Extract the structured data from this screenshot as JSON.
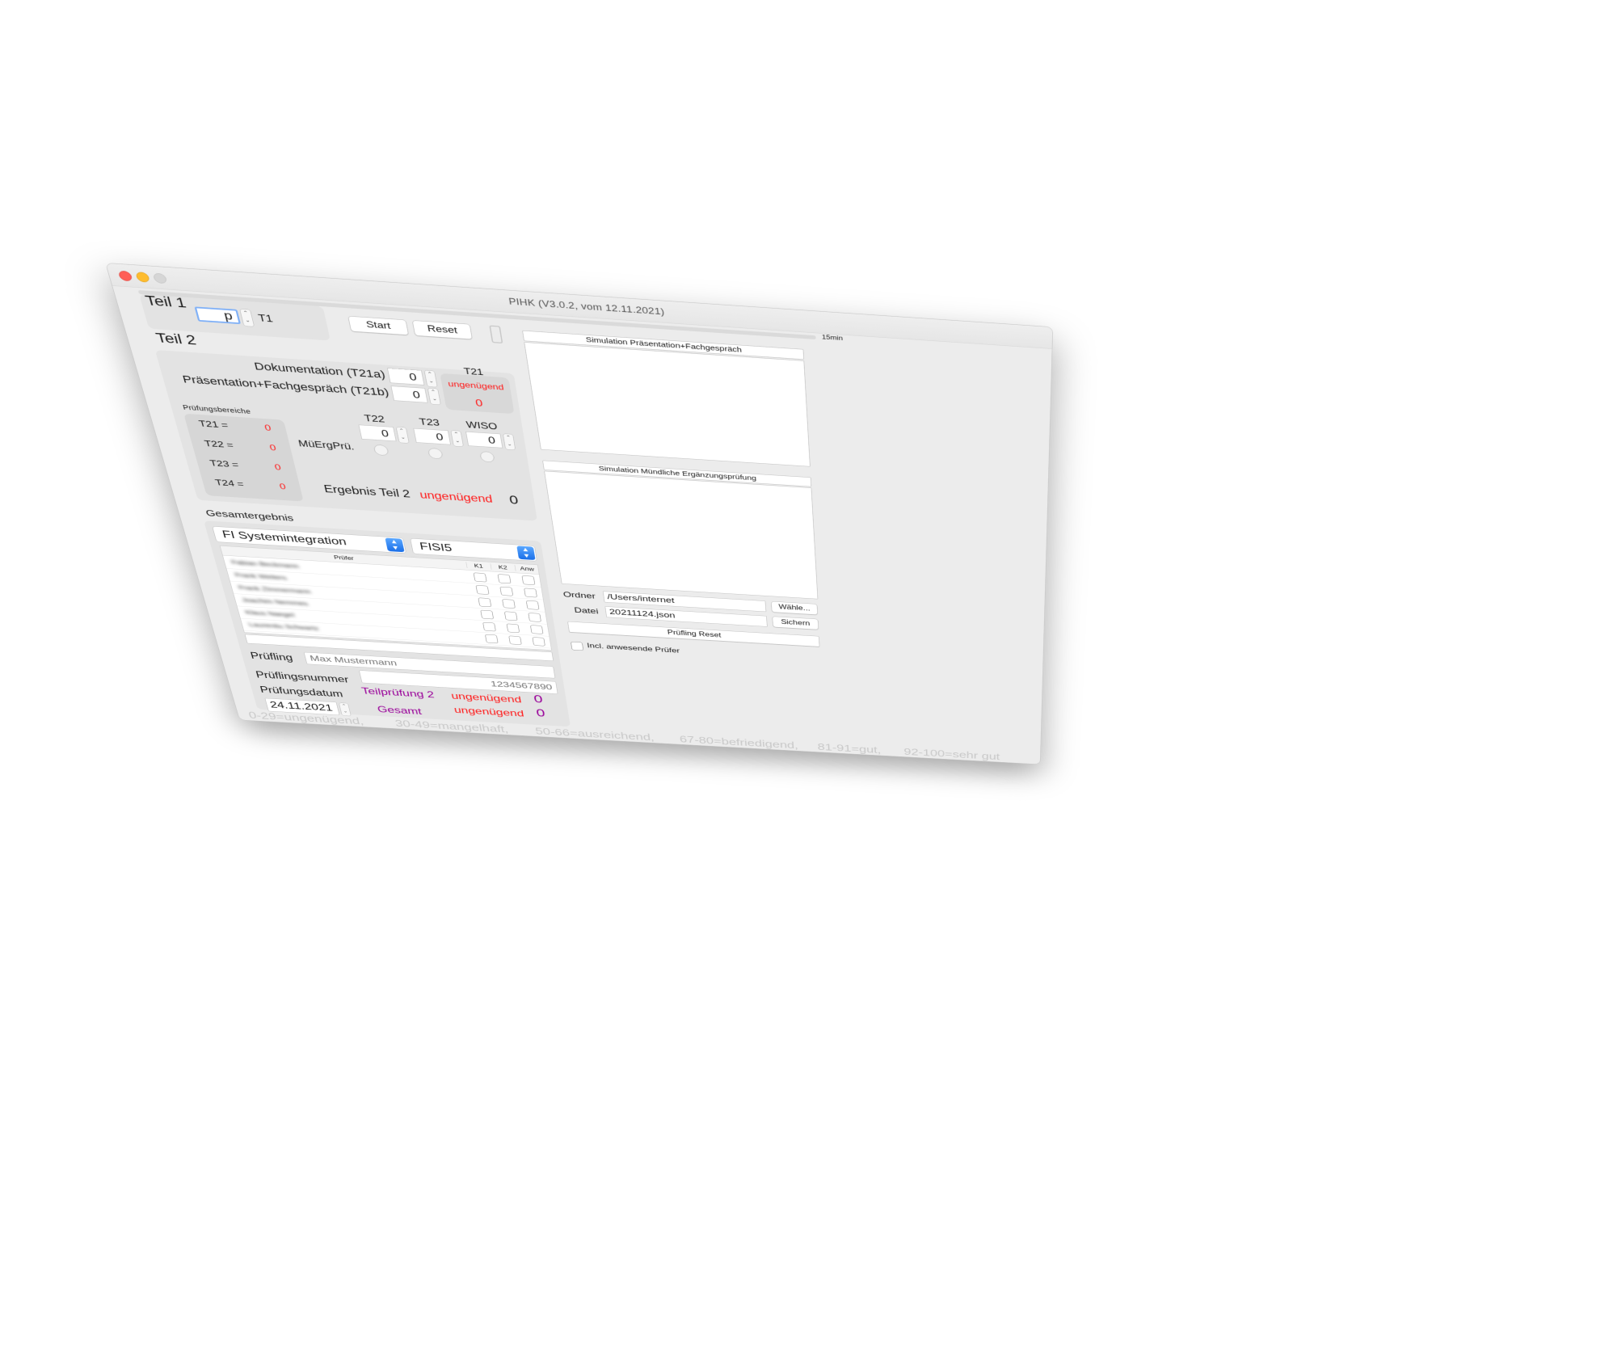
{
  "window": {
    "title": "PIHK   (V3.0.2, vom 12.11.2021)",
    "traffic_light_colors": [
      "#ff5f57",
      "#febc2e",
      "#d6d6d6"
    ]
  },
  "teil1": {
    "heading": "Teil 1",
    "input_value": "p",
    "t1_label": "T1",
    "start_label": "Start",
    "reset_label": "Reset"
  },
  "timer": {
    "label": "15min",
    "progress": 0
  },
  "teil2": {
    "heading": "Teil 2",
    "dok_label": "Dokumentation (T21a)",
    "dok_value": "0",
    "praes_label": "Präsentation+Fachgespräch (T21b)",
    "praes_value": "0",
    "t21_title": "T21",
    "t21_grade": "ungenügend",
    "t21_points": "0",
    "bereiche_title": "Prüfungsbereiche",
    "bereiche": [
      {
        "label": "T21 =",
        "value": "0"
      },
      {
        "label": "T22 =",
        "value": "0"
      },
      {
        "label": "T23 =",
        "value": "0"
      },
      {
        "label": "T24 =",
        "value": "0"
      }
    ],
    "t22_label": "T22",
    "t22_value": "0",
    "t23_label": "T23",
    "t23_value": "0",
    "wiso_label": "WISO",
    "wiso_value": "0",
    "mueerg_label": "MüErgPrü.",
    "ergebnis_label": "Ergebnis Teil 2",
    "ergebnis_grade": "ungenügend",
    "ergebnis_points": "0"
  },
  "gesamt": {
    "heading": "Gesamtergebnis",
    "beruf_selected": "FI Systemintegration",
    "kurs_selected": "FISI5",
    "table_headers": [
      "Prüfer",
      "K1",
      "K2",
      "Anw"
    ],
    "pruefer": [
      "Fabian Beckmann",
      "Frank Weiters",
      "Frank Zimmermann",
      "Joachim Nemmes",
      "Klaus Naegel",
      "Laurentiu Schwartz"
    ],
    "pruefling_label": "Prüfling",
    "pruefling_placeholder": "Max Mustermann",
    "nummer_label": "Prüflingsnummer",
    "nummer_placeholder": "1234567890",
    "datum_label": "Prüfungsdatum",
    "datum_value": "24.11.2021",
    "teilpruefung_label": "Teilprüfung 2",
    "teilpruefung_grade": "ungenügend",
    "teilpruefung_points": "0",
    "gesamt_label": "Gesamt",
    "gesamt_grade": "ungenügend",
    "gesamt_points": "0"
  },
  "simulation": {
    "praes_title": "Simulation Präsentation+Fachgespräch",
    "mueerg_title": "Simulation Mündliche Ergänzungsprüfung"
  },
  "files": {
    "ordner_label": "Ordner",
    "ordner_value": "/Users/internet",
    "waehle_label": "Wähle...",
    "datei_label": "Datei",
    "datei_value": "20211124.json",
    "sichern_label": "Sichern",
    "reset_label": "Prüfling Reset",
    "incl_label": "Incl. anwesende Prüfer"
  },
  "footer": {
    "scale": [
      "0-29=ungenügend,",
      "30-49=mangelhaft,",
      "50-66=ausreichend,",
      "67-80=befriedigend,",
      "81-91=gut,",
      "92-100=sehr gut"
    ]
  },
  "colors": {
    "fail": "#ff1a1a",
    "result": "#990099",
    "accent": "#1a6fe8"
  }
}
